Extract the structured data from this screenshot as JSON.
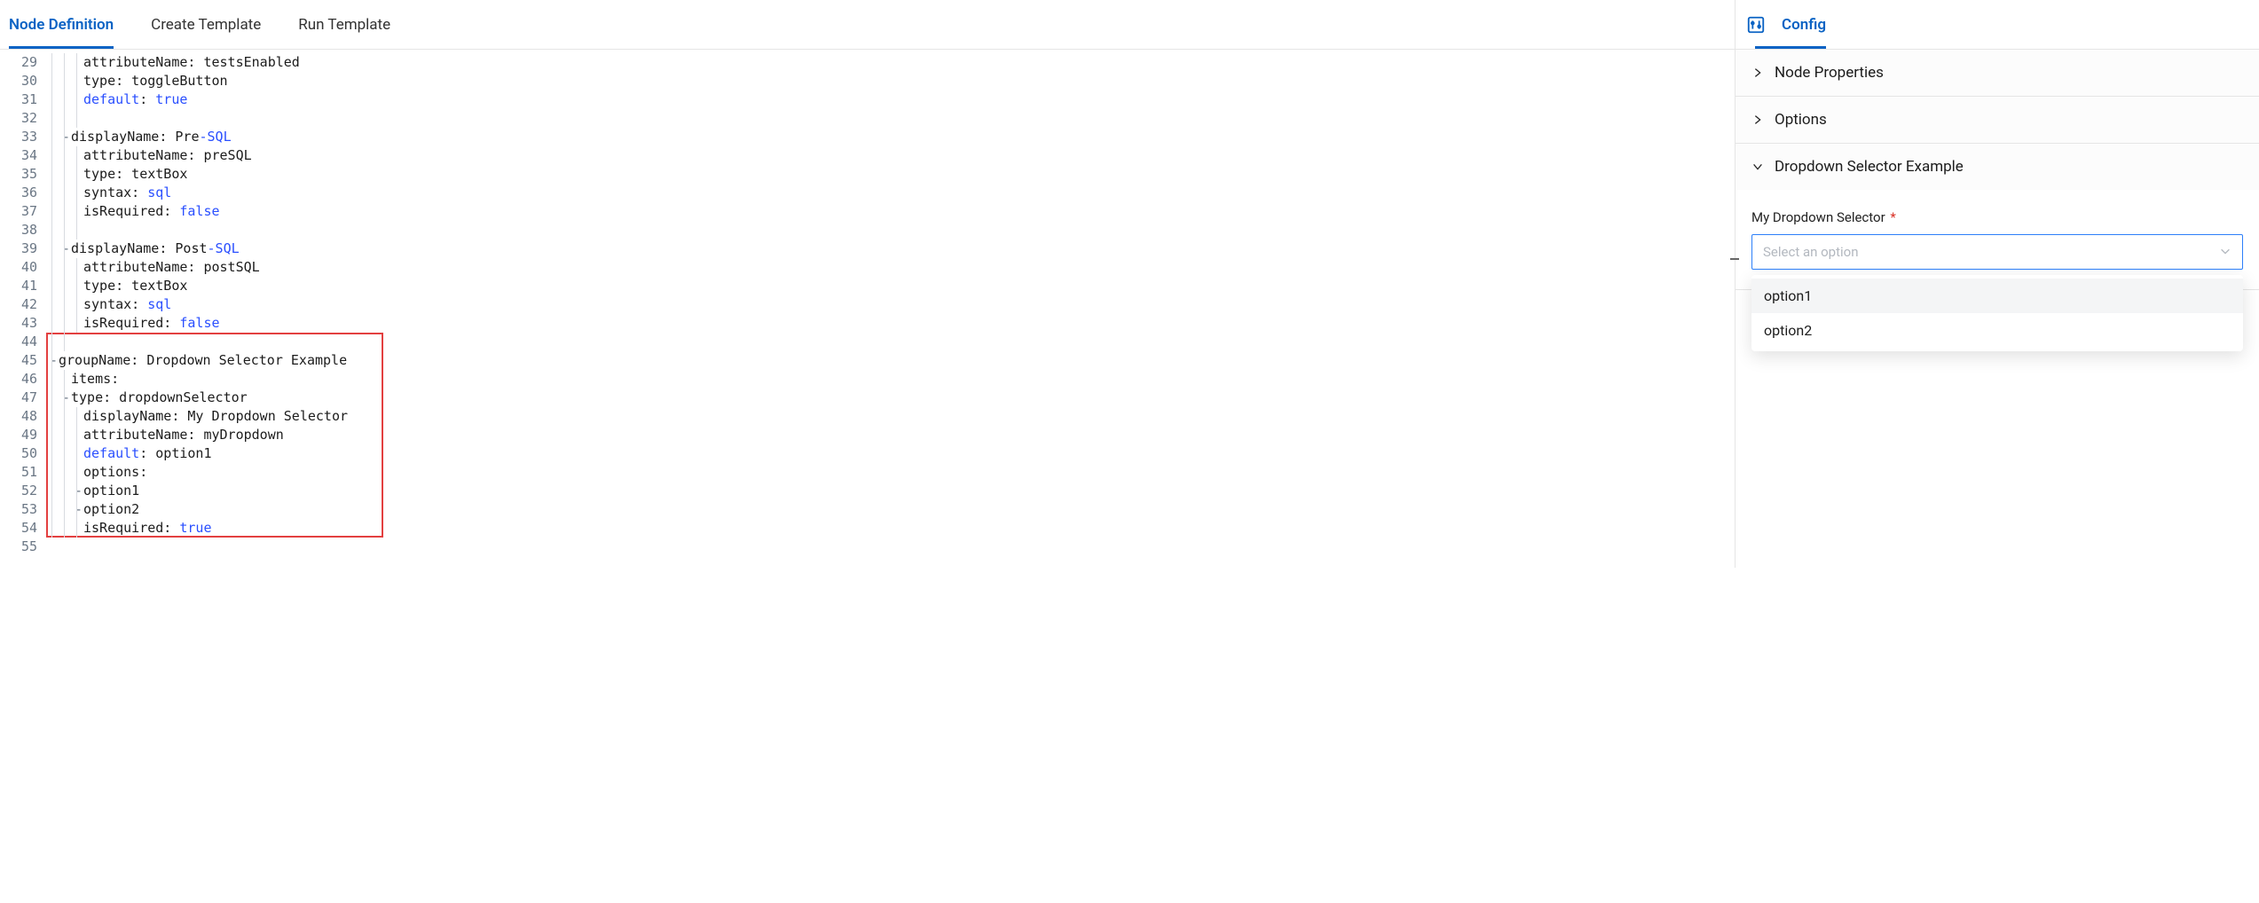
{
  "leftTabs": {
    "nodeDefinition": "Node Definition",
    "createTemplate": "Create Template",
    "runTemplate": "Run Template"
  },
  "editor": {
    "startLine": 29,
    "highlight": {
      "topRow": 15,
      "heightRows": 11,
      "leftPx": 0,
      "widthPx": 380
    },
    "lines": {
      "29": {
        "indentUnits": 3,
        "guides": [
          0,
          1,
          2
        ],
        "fold": "",
        "tokens": [
          {
            "t": "attributeName: testsEnabled",
            "c": "k-key"
          }
        ]
      },
      "30": {
        "indentUnits": 3,
        "guides": [
          0,
          1,
          2
        ],
        "fold": "",
        "tokens": [
          {
            "t": "type: toggleButton",
            "c": "k-key"
          }
        ]
      },
      "31": {
        "indentUnits": 3,
        "guides": [
          0,
          1,
          2
        ],
        "fold": "",
        "tokens": [
          {
            "t": "default",
            "c": "tok-default"
          },
          {
            "t": ": ",
            "c": "k-key"
          },
          {
            "t": "true",
            "c": "v-bool"
          }
        ]
      },
      "32": {
        "indentUnits": 3,
        "guides": [
          0,
          1,
          2
        ],
        "fold": "",
        "tokens": []
      },
      "33": {
        "indentUnits": 2,
        "guides": [
          0,
          1
        ],
        "fold": "-",
        "tokens": [
          {
            "t": "displayName: Pre",
            "c": "k-key"
          },
          {
            "t": "-SQL",
            "c": "v-sql"
          }
        ]
      },
      "34": {
        "indentUnits": 3,
        "guides": [
          0,
          1,
          2
        ],
        "fold": "",
        "tokens": [
          {
            "t": "attributeName: preSQL",
            "c": "k-key"
          }
        ]
      },
      "35": {
        "indentUnits": 3,
        "guides": [
          0,
          1,
          2
        ],
        "fold": "",
        "tokens": [
          {
            "t": "type: textBox",
            "c": "k-key"
          }
        ]
      },
      "36": {
        "indentUnits": 3,
        "guides": [
          0,
          1,
          2
        ],
        "fold": "",
        "tokens": [
          {
            "t": "syntax: ",
            "c": "k-key"
          },
          {
            "t": "sql",
            "c": "v-sql"
          }
        ]
      },
      "37": {
        "indentUnits": 3,
        "guides": [
          0,
          1,
          2
        ],
        "fold": "",
        "tokens": [
          {
            "t": "isRequired: ",
            "c": "k-key"
          },
          {
            "t": "false",
            "c": "v-bool"
          }
        ]
      },
      "38": {
        "indentUnits": 3,
        "guides": [
          0,
          1,
          2
        ],
        "fold": "",
        "tokens": []
      },
      "39": {
        "indentUnits": 2,
        "guides": [
          0,
          1
        ],
        "fold": "-",
        "tokens": [
          {
            "t": "displayName: Post",
            "c": "k-key"
          },
          {
            "t": "-SQL",
            "c": "v-sql"
          }
        ]
      },
      "40": {
        "indentUnits": 3,
        "guides": [
          0,
          1,
          2
        ],
        "fold": "",
        "tokens": [
          {
            "t": "attributeName: postSQL",
            "c": "k-key"
          }
        ]
      },
      "41": {
        "indentUnits": 3,
        "guides": [
          0,
          1,
          2
        ],
        "fold": "",
        "tokens": [
          {
            "t": "type: textBox",
            "c": "k-key"
          }
        ]
      },
      "42": {
        "indentUnits": 3,
        "guides": [
          0,
          1,
          2
        ],
        "fold": "",
        "tokens": [
          {
            "t": "syntax: ",
            "c": "k-key"
          },
          {
            "t": "sql",
            "c": "v-sql"
          }
        ]
      },
      "43": {
        "indentUnits": 3,
        "guides": [
          0,
          1,
          2
        ],
        "fold": "",
        "tokens": [
          {
            "t": "isRequired: ",
            "c": "k-key"
          },
          {
            "t": "false",
            "c": "v-bool"
          }
        ]
      },
      "44": {
        "indentUnits": 2,
        "guides": [
          0,
          1
        ],
        "fold": "",
        "tokens": []
      },
      "45": {
        "indentUnits": 1,
        "guides": [
          0
        ],
        "fold": "-",
        "tokens": [
          {
            "t": "groupName: Dropdown Selector Example",
            "c": "k-key"
          }
        ]
      },
      "46": {
        "indentUnits": 2,
        "guides": [
          0,
          1
        ],
        "fold": "",
        "tokens": [
          {
            "t": "items:",
            "c": "k-key"
          }
        ]
      },
      "47": {
        "indentUnits": 2,
        "guides": [
          0,
          1
        ],
        "fold": "-",
        "tokens": [
          {
            "t": "type: dropdownSelector",
            "c": "k-key"
          }
        ]
      },
      "48": {
        "indentUnits": 3,
        "guides": [
          0,
          1,
          2
        ],
        "fold": "",
        "tokens": [
          {
            "t": "displayName: My Dropdown Selector",
            "c": "k-key"
          }
        ]
      },
      "49": {
        "indentUnits": 3,
        "guides": [
          0,
          1,
          2
        ],
        "fold": "",
        "tokens": [
          {
            "t": "attributeName: myDropdown",
            "c": "k-key"
          }
        ]
      },
      "50": {
        "indentUnits": 3,
        "guides": [
          0,
          1,
          2
        ],
        "fold": "",
        "tokens": [
          {
            "t": "default",
            "c": "tok-default"
          },
          {
            "t": ": option1",
            "c": "k-key"
          }
        ]
      },
      "51": {
        "indentUnits": 3,
        "guides": [
          0,
          1,
          2
        ],
        "fold": "",
        "tokens": [
          {
            "t": "options:",
            "c": "k-key"
          }
        ]
      },
      "52": {
        "indentUnits": 3,
        "guides": [
          0,
          1,
          2
        ],
        "fold": "-",
        "tokens": [
          {
            "t": "option1",
            "c": "v-opt"
          }
        ]
      },
      "53": {
        "indentUnits": 3,
        "guides": [
          0,
          1,
          2
        ],
        "fold": "-",
        "tokens": [
          {
            "t": "option2",
            "c": "v-opt"
          }
        ]
      },
      "54": {
        "indentUnits": 3,
        "guides": [
          0,
          1,
          2
        ],
        "fold": "",
        "tokens": [
          {
            "t": "isRequired: ",
            "c": "k-key"
          },
          {
            "t": "true",
            "c": "v-bool"
          }
        ]
      },
      "55": {
        "indentUnits": 0,
        "guides": [],
        "fold": "",
        "tokens": []
      }
    },
    "indentWidthPx": 14
  },
  "rightPanel": {
    "tab": "Config",
    "sections": {
      "nodeProperties": "Node Properties",
      "options": "Options",
      "dropdownExample": "Dropdown Selector Example"
    },
    "dropdown": {
      "label": "My Dropdown Selector",
      "requiredMark": "*",
      "placeholder": "Select an option",
      "options": {
        "0": "option1",
        "1": "option2"
      }
    }
  }
}
